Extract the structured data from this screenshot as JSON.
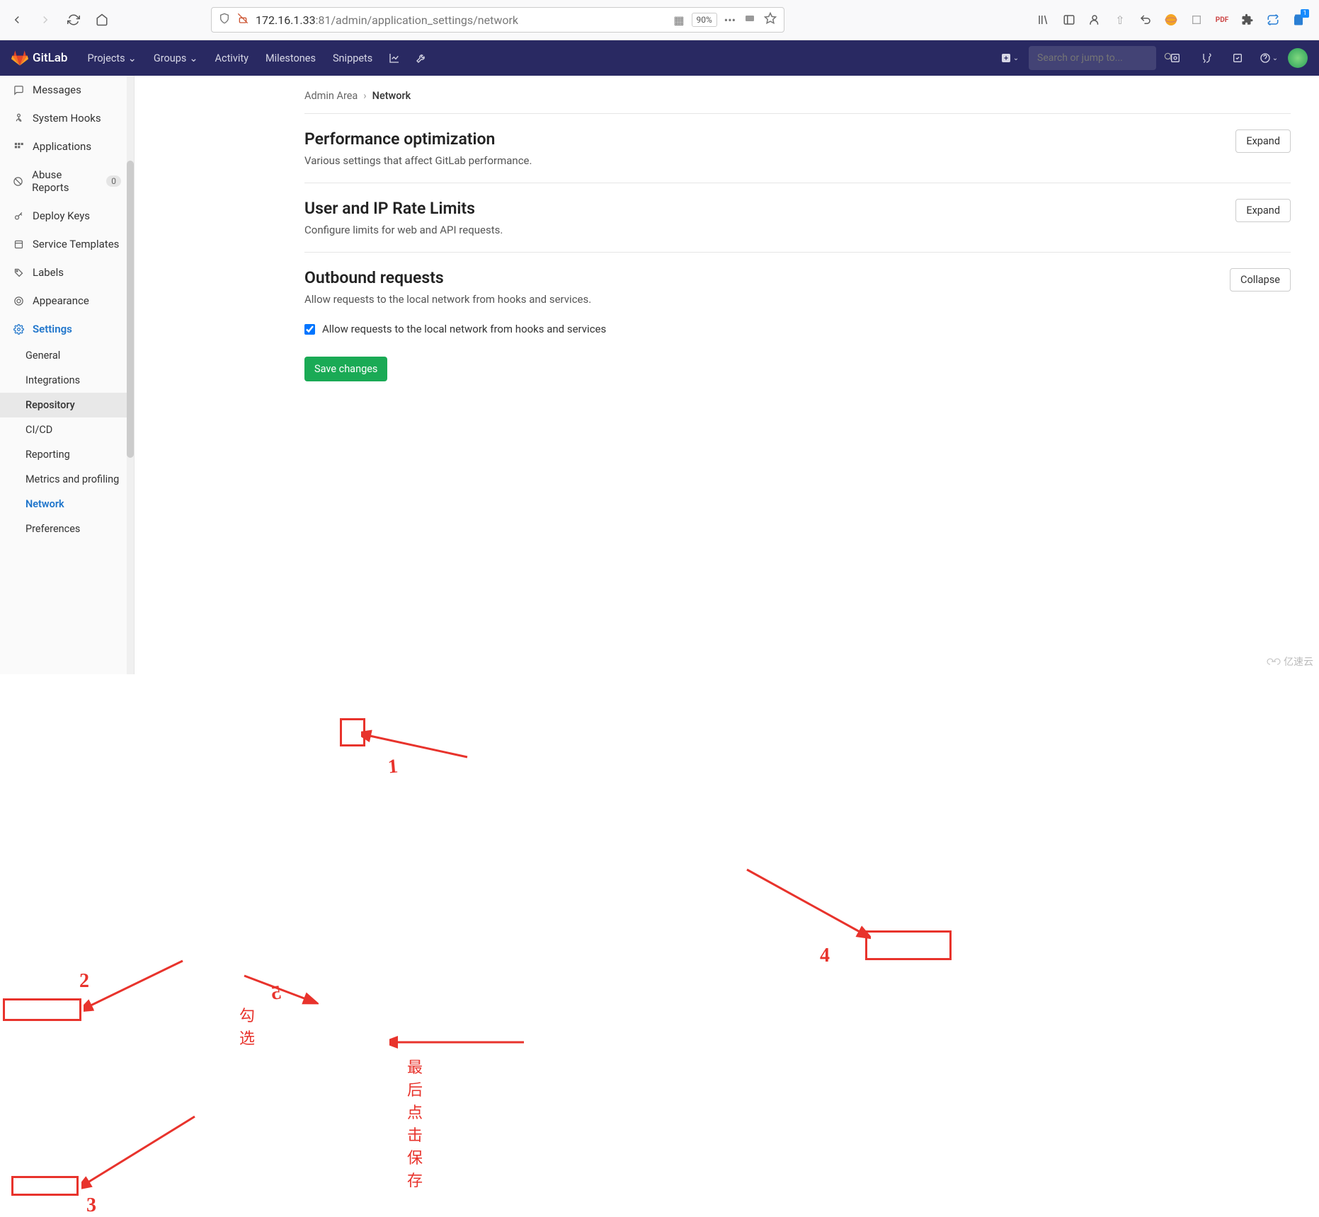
{
  "browser": {
    "url_prefix": "172.16.1.33",
    "url_rest": ":81/admin/application_settings/network",
    "zoom": "90%",
    "badge": "1"
  },
  "header": {
    "brand": "GitLab",
    "nav": {
      "projects": "Projects",
      "groups": "Groups",
      "activity": "Activity",
      "milestones": "Milestones",
      "snippets": "Snippets"
    },
    "search_placeholder": "Search or jump to..."
  },
  "sidebar": {
    "items": [
      {
        "icon": "message",
        "label": "Messages"
      },
      {
        "icon": "hook",
        "label": "System Hooks"
      },
      {
        "icon": "apps",
        "label": "Applications"
      },
      {
        "icon": "abuse",
        "label": "Abuse Reports",
        "count": "0"
      },
      {
        "icon": "key",
        "label": "Deploy Keys"
      },
      {
        "icon": "template",
        "label": "Service Templates"
      },
      {
        "icon": "label",
        "label": "Labels"
      },
      {
        "icon": "appearance",
        "label": "Appearance"
      },
      {
        "icon": "gear",
        "label": "Settings"
      }
    ],
    "subs": [
      {
        "label": "General"
      },
      {
        "label": "Integrations"
      },
      {
        "label": "Repository"
      },
      {
        "label": "CI/CD"
      },
      {
        "label": "Reporting"
      },
      {
        "label": "Metrics and profiling"
      },
      {
        "label": "Network"
      },
      {
        "label": "Preferences"
      }
    ]
  },
  "breadcrumb": {
    "root": "Admin Area",
    "current": "Network"
  },
  "sections": {
    "perf": {
      "title": "Performance optimization",
      "desc": "Various settings that affect GitLab performance.",
      "btn": "Expand"
    },
    "rate": {
      "title": "User and IP Rate Limits",
      "desc": "Configure limits for web and API requests.",
      "btn": "Expand"
    },
    "out": {
      "title": "Outbound requests",
      "desc": "Allow requests to the local network from hooks and services.",
      "btn": "Collapse",
      "checkbox_label": "Allow requests to the local network from hooks and services",
      "save": "Save changes"
    }
  },
  "annotations": {
    "n1": "1",
    "n2": "2",
    "n3": "3",
    "n4": "4",
    "n5": "5",
    "check_text": "勾选",
    "save_text": "最后点击保存"
  },
  "watermark": "亿速云"
}
